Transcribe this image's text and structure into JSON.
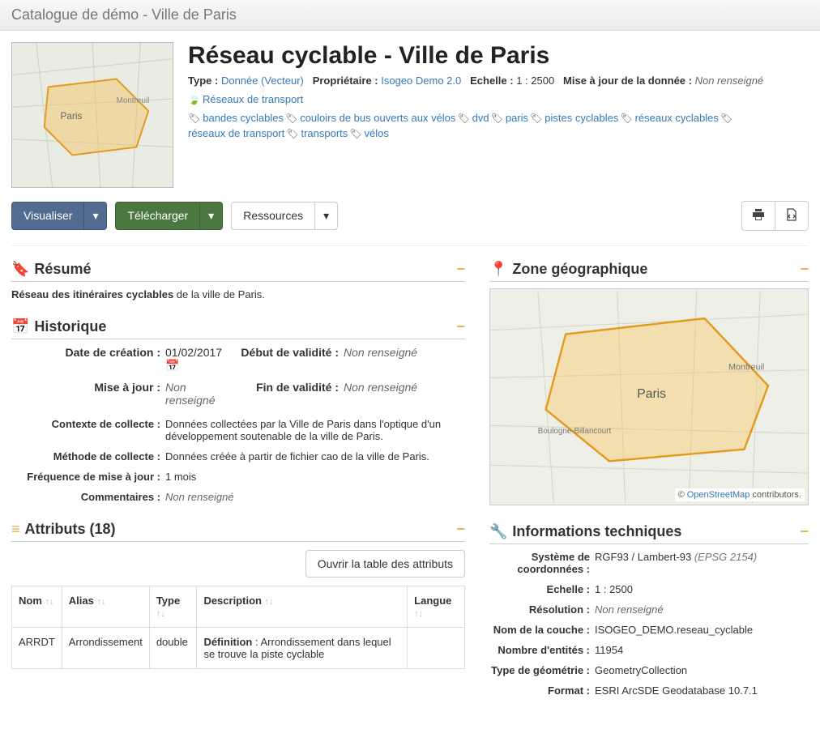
{
  "topbar_title": "Catalogue de démo - Ville de Paris",
  "title": "Réseau cyclable - Ville de Paris",
  "meta": {
    "type_label": "Type :",
    "type_value": "Donnée (Vecteur)",
    "owner_label": "Propriétaire :",
    "owner_value": "Isogeo Demo 2.0",
    "scale_label": "Echelle :",
    "scale_value": "1 : 2500",
    "update_label": "Mise à jour de la donnée :",
    "update_value": "Non renseigné"
  },
  "theme": "Réseaux de transport",
  "tags": [
    "bandes cyclables",
    "couloirs de bus ouverts aux vélos",
    "dvd",
    "paris",
    "pistes cyclables",
    "réseaux cyclables",
    "réseaux de transport",
    "transports",
    "vélos"
  ],
  "buttons": {
    "visualize": "Visualiser",
    "download": "Télécharger",
    "resources": "Ressources"
  },
  "sections": {
    "resume": "Résumé",
    "history": "Historique",
    "attrs": "Attributs (18)",
    "geozone": "Zone géographique",
    "tech": "Informations techniques"
  },
  "summary_strong": "Réseau des itinéraires cyclables",
  "summary_rest": " de la ville de Paris.",
  "history": {
    "creation_label": "Date de création :",
    "creation_value": "01/02/2017",
    "valid_start_label": "Début de validité :",
    "valid_start_value": "Non renseigné",
    "update_label": "Mise à jour :",
    "update_value": "Non renseigné",
    "valid_end_label": "Fin de validité :",
    "valid_end_value": "Non renseigné",
    "context_label": "Contexte de collecte :",
    "context_value": "Données collectées par la Ville de Paris dans l'optique d'un développement soutenable de la ville de Paris.",
    "method_label": "Méthode de collecte :",
    "method_value": "Données créée à partir de fichier cao de la ville de Paris.",
    "freq_label": "Fréquence de mise à jour :",
    "freq_value": "1 mois",
    "comments_label": "Commentaires :",
    "comments_value": "Non renseigné"
  },
  "attrs_button": "Ouvrir la table des attributs",
  "attr_headers": {
    "name": "Nom",
    "alias": "Alias",
    "type": "Type",
    "desc": "Description",
    "lang": "Langue"
  },
  "attr_row": {
    "name": "ARRDT",
    "alias": "Arrondissement",
    "type": "double",
    "desc_label": "Définition",
    "desc_value": " : Arrondissement dans lequel se trouve la piste cyclable",
    "lang": ""
  },
  "map_attrib_pre": "© ",
  "map_attrib_link": "OpenStreetMap",
  "map_attrib_post": " contributors.",
  "tech": {
    "srs_label": "Système de coordonnées :",
    "srs_value": "RGF93 / Lambert-93",
    "srs_epsg": "(EPSG 2154)",
    "scale_label": "Echelle :",
    "scale_value": "1 : 2500",
    "res_label": "Résolution :",
    "res_value": "Non renseigné",
    "layer_label": "Nom de la couche :",
    "layer_value": "ISOGEO_DEMO.reseau_cyclable",
    "count_label": "Nombre d'entités :",
    "count_value": "11954",
    "geom_label": "Type de géométrie :",
    "geom_value": "GeometryCollection",
    "format_label": "Format :",
    "format_value": "ESRI ArcSDE Geodatabase 10.7.1"
  }
}
